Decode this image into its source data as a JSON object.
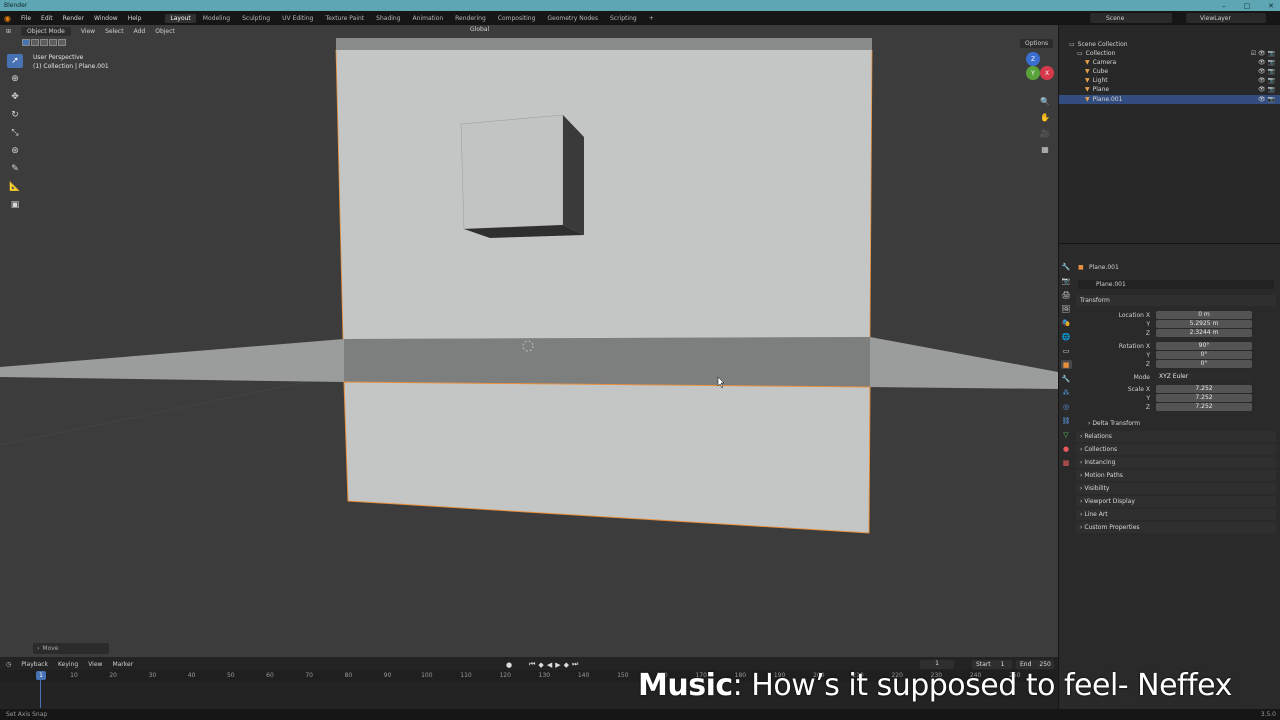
{
  "titlebar": {
    "title": "Blender",
    "controls": [
      "–",
      "□",
      "✕"
    ]
  },
  "menubar": {
    "items": [
      "File",
      "Edit",
      "Render",
      "Window",
      "Help"
    ],
    "workspaces": [
      "Layout",
      "Modeling",
      "Sculpting",
      "UV Editing",
      "Texture Paint",
      "Shading",
      "Animation",
      "Rendering",
      "Compositing",
      "Geometry Nodes",
      "Scripting",
      "+"
    ],
    "active_workspace": "Layout",
    "scene": "Scene",
    "view_layer": "ViewLayer"
  },
  "viewport": {
    "mode": "Object Mode",
    "header_items": [
      "View",
      "Select",
      "Add",
      "Object"
    ],
    "orientation": "Global",
    "options_label": "Options",
    "perspective_label": "User Perspective",
    "collection_label": "(1) Collection | Plane.001",
    "last_operator": "Move",
    "tools": [
      "select-icon",
      "cursor-icon",
      "move-icon",
      "rotate-icon",
      "scale-icon",
      "transform-icon",
      "annotate-icon",
      "measure-icon",
      "add-cube-icon"
    ],
    "colors": {
      "background": "#3c3c3c",
      "plane": "#c4c6c6",
      "selection": "#e8903c"
    }
  },
  "timeline": {
    "header_items": [
      "Playback",
      "Keying",
      "View",
      "Marker"
    ],
    "ticks": [
      "10",
      "20",
      "30",
      "40",
      "50",
      "60",
      "70",
      "80",
      "90",
      "100",
      "110",
      "120",
      "130",
      "140",
      "150",
      "160",
      "170",
      "180",
      "190",
      "200",
      "210",
      "220",
      "230",
      "240",
      "250"
    ],
    "current_frame": "1",
    "start_label": "Start",
    "start_value": "1",
    "end_label": "End",
    "end_value": "250"
  },
  "statusbar": {
    "text": "Set Axis Snap",
    "version": "3.5.0"
  },
  "outliner": {
    "root": "Scene Collection",
    "collection": "Collection",
    "items": [
      {
        "name": "Camera",
        "icon": "camera-icon",
        "color": "#e8a04a"
      },
      {
        "name": "Cube",
        "icon": "mesh-icon",
        "color": "#e8a04a"
      },
      {
        "name": "Light",
        "icon": "light-icon",
        "color": "#e8a04a"
      },
      {
        "name": "Plane",
        "icon": "mesh-icon",
        "color": "#e8a04a"
      },
      {
        "name": "Plane.001",
        "icon": "mesh-icon",
        "color": "#e8a04a",
        "selected": true
      }
    ]
  },
  "properties": {
    "object_name": "Plane.001",
    "object_field": "Plane.001",
    "transform_header": "Transform",
    "location_label": "Location X",
    "location": [
      "0 m",
      "5.2925 m",
      "2.3244 m"
    ],
    "rotation_label": "Rotation X",
    "rotation": [
      "90°",
      "0°",
      "0°"
    ],
    "mode_label": "Mode",
    "mode_value": "XYZ Euler",
    "scale_label": "Scale X",
    "scale": [
      "7.252",
      "7.252",
      "7.252"
    ],
    "axis_y": "Y",
    "axis_z": "Z",
    "delta_transform": "Delta Transform",
    "sections": [
      "Relations",
      "Collections",
      "Instancing",
      "Motion Paths",
      "Visibility",
      "Viewport Display",
      "Line Art",
      "Custom Properties"
    ]
  },
  "overlay": {
    "music_prefix": "Music",
    "music_title": ": How’s it supposed to feel- Neffex"
  }
}
